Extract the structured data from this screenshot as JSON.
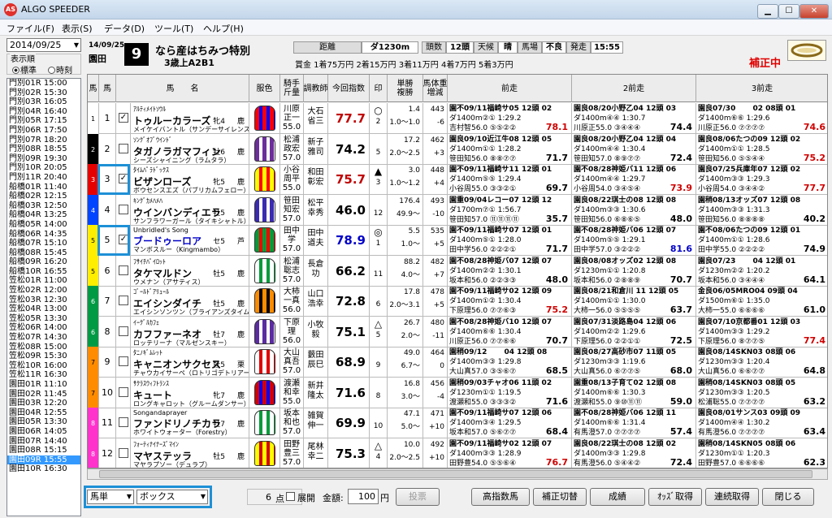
{
  "window": {
    "title": "ALGO SPEEDER",
    "logo": "AS"
  },
  "menu": [
    "ファイル(F)",
    "表示(S)",
    "データ(D)",
    "ツール(T)",
    "ヘルプ(H)"
  ],
  "sidebar": {
    "date": "2014/09/25",
    "order_label": "表示順",
    "radio_standard": "標準",
    "radio_time": "時刻",
    "races": [
      "門別01R 15:00",
      "門別02R 15:30",
      "門別03R 16:05",
      "門別04R 16:40",
      "門別05R 17:15",
      "門別06R 17:50",
      "門別07R 18:20",
      "門別08R 18:55",
      "門別09R 19:30",
      "門別10R 20:05",
      "門別11R 20:40",
      "船橋01R 11:40",
      "船橋02R 12:15",
      "船橋03R 12:50",
      "船橋04R 13:25",
      "船橋05R 14:00",
      "船橋06R 14:35",
      "船橋07R 15:10",
      "船橋08R 15:45",
      "船橋09R 16:20",
      "船橋10R 16:55",
      "笠松01R 11:00",
      "笠松02R 12:00",
      "笠松03R 12:30",
      "笠松04R 13:00",
      "笠松05R 13:30",
      "笠松06R 14:00",
      "笠松07R 14:30",
      "笠松08R 15:00",
      "笠松09R 15:30",
      "笠松10R 16:00",
      "笠松11R 16:30",
      "園田01R 11:10",
      "園田02R 11:45",
      "園田03R 12:20",
      "園田04R 12:55",
      "園田05R 13:30",
      "園田06R 14:05",
      "園田07R 14:40",
      "園田08R 15:15",
      "園田09R 15:55",
      "園田10R 16:30"
    ],
    "selected_index": 40
  },
  "race": {
    "date": "14/09/25",
    "track": "園田",
    "number": "9",
    "name": "なら産はちみつ特別",
    "condition": "3歳上A2B1",
    "info": [
      {
        "label": "距離",
        "value": "ダ1230m"
      },
      {
        "label": "頭数",
        "value": "12頭"
      },
      {
        "label": "天候",
        "value": "晴"
      },
      {
        "label": "馬場",
        "value": "不良"
      },
      {
        "label": "発走",
        "value": "15:55"
      }
    ],
    "prize": "賞金 1着75万円  2着15万円  3着11万円  4着7万円  5着3万円",
    "status": "補正中"
  },
  "headers": [
    "馬",
    "馬",
    "馬　　名",
    "服色",
    "騎手\n斤量",
    "調教師",
    "今回指数",
    "印",
    "単勝\n複勝",
    "馬体重\n増減",
    "前走",
    "2前走",
    "3前走"
  ],
  "horses": [
    {
      "frame": "1",
      "num": "1",
      "checked": true,
      "sire": "ｱﾙﾃｨﾒｲﾄｿｳﾙ",
      "sex": "牝4",
      "coat": "鹿",
      "name": "トゥルーカラーズ",
      "dam": "メイケイバントル（サンデーサイレンス）",
      "silks": [
        "#ff0000",
        "#0000ff"
      ],
      "jockey": [
        "川原",
        "正一",
        "55.0"
      ],
      "trainer": [
        "大石",
        "省三"
      ],
      "index": "77.7",
      "index_color": "red",
      "mark": "○",
      "mark_num": "2",
      "odds": [
        "1.4",
        "1.0～1.0"
      ],
      "weight": [
        "443",
        "-6"
      ],
      "prev": [
        [
          "園不09/11福崎サ05 12頭 02",
          "ダ1400m②① 1:29.2",
          "吉村智56.0 ⑤⑤②②  78.1",
          "red"
        ],
        [
          "園良08/20小野乙04 12頭 03",
          "ダ1400m④④ 1:30.7",
          "川原正55.0 ③④④④  74.4",
          ""
        ],
        [
          "園良07/30　　 02 08頭 01",
          "ダ1400m⑥⑥ 1:29.6",
          "川原正56.0 ⑦⑦⑦⑦  74.6",
          "red"
        ]
      ]
    },
    {
      "frame": "2",
      "num": "2",
      "checked": false,
      "sire": "ｿﾝｸﾞｵﾌﾞｳｲﾝﾄﾞ",
      "sex": "牡6",
      "coat": "鹿",
      "name": "タガノラガマフィン",
      "dam": "シーズシャイニング（ラムタラ）",
      "silks": [
        "#6c2e9a",
        "#ffffff"
      ],
      "jockey": [
        "松浦",
        "政宏",
        "57.0"
      ],
      "trainer": [
        "新子",
        "雅司"
      ],
      "index": "74.2",
      "index_color": "",
      "mark": "",
      "mark_num": "5",
      "odds": [
        "17.2",
        "2.0～2.5"
      ],
      "weight": [
        "462",
        "+3"
      ],
      "prev": [
        [
          "園良09/10近江牛08 12頭 05",
          "ダ1400m①① 1:28.2",
          "笹田知56.0 ⑧⑧⑦⑦  71.7",
          ""
        ],
        [
          "園良08/20小野乙04 12頭 04",
          "ダ1400m④④ 1:30.4",
          "笹田知57.0 ⑧⑨⑦⑦  72.4",
          ""
        ],
        [
          "園良08/06たつの09 12頭 02",
          "ダ1400m①① 1:28.5",
          "笹田知56.0 ⑤⑤④④  75.2",
          "red"
        ]
      ]
    },
    {
      "frame": "3",
      "num": "3",
      "checked": true,
      "sire": "ﾀｲﾑﾊﾟﾗﾄﾞｯｸｽ",
      "sex": "牝5",
      "coat": "鹿",
      "name": "ビザンローズ",
      "dam": "ボウセンスエズ（パブリカムフェロー）",
      "silks": [
        "#ffff00",
        "#ff0000"
      ],
      "jockey": [
        "小谷",
        "周平",
        "55.0"
      ],
      "trainer": [
        "和田",
        "彰宏"
      ],
      "index": "75.7",
      "index_color": "red",
      "mark": "▲",
      "mark_num": "3",
      "odds": [
        "3.0",
        "1.0～1.2"
      ],
      "weight": [
        "448",
        "+4"
      ],
      "prev": [
        [
          "園不09/11福崎サ11 12頭 01",
          "ダ1400m⑤⑤ 1:29.4",
          "小谷周55.0 ③③②①  69.7",
          ""
        ],
        [
          "園不08/28神姫バ11 12頭 06",
          "ダ1400m④④ 1:29.7",
          "小谷周54.0 ③④⑤④  73.9",
          "red"
        ],
        [
          "園良07/25兵庫年07 12頭 02",
          "ダ1400m③③ 1:29.3",
          "小谷周54.0 ③④④②  77.7",
          "red"
        ]
      ]
    },
    {
      "frame": "4",
      "num": "4",
      "checked": false,
      "sire": "ｷﾝｸﾞｶﾒﾊﾒﾊ",
      "sex": "牡5",
      "coat": "鹿",
      "name": "ウインバンディエラ",
      "dam": "サンフラワーガール（タイキシャトル）",
      "silks": [
        "#3a2bb0",
        "#ffffff"
      ],
      "jockey": [
        "笹田",
        "知宏",
        "57.0"
      ],
      "trainer": [
        "松平",
        "幸秀"
      ],
      "index": "46.0",
      "index_color": "",
      "mark": "",
      "mark_num": "12",
      "odds": [
        "176.4",
        "49.9～"
      ],
      "weight": [
        "493",
        "-10"
      ],
      "prev": [
        [
          "園重09/04レコー07 12頭 12",
          "ダ1700m⑦① 1:56.7",
          "笹田知57.0 ⑪⑪⑪⑪  35.7",
          ""
        ],
        [
          "園良08/22琪士の08 12頭 08",
          "ダ1400m③③ 1:30.6",
          "笹田知56.0 ⑥⑧⑥⑤  48.0",
          ""
        ],
        [
          "園稍08/13オッズ07 12頭 08",
          "ダ1400m③③ 1:31.3",
          "笹田知56.0 ⑧⑧⑧⑧  40.2",
          ""
        ]
      ]
    },
    {
      "frame": "5",
      "num": "5",
      "checked": true,
      "sire": "Unbridled's Song",
      "sex": "セ5",
      "coat": "芦",
      "name": "ブードゥーロア",
      "dam": "マンボスルー（Kingmambo）",
      "silks": [
        "#009b3a",
        "#ff0000"
      ],
      "jockey": [
        "田中",
        "学",
        "57.0"
      ],
      "trainer": [
        "田中",
        "道夫"
      ],
      "index": "78.9",
      "index_color": "blue",
      "mark": "◎",
      "mark_num": "1",
      "odds": [
        "5.5",
        "1.0～"
      ],
      "weight": [
        "535",
        "+5"
      ],
      "prev": [
        [
          "園不09/11福崎サ07 12頭 01",
          "ダ1400m⑤① 1:28.0",
          "田中学56.0 ②②②①  71.7",
          ""
        ],
        [
          "園不08/28神姫バ06 12頭 07",
          "ダ1400m⑤⑤ 1:29.1",
          "田中学57.0 ③②②②  81.6",
          "blue"
        ],
        [
          "園不08/06たつの09 12頭 01",
          "ダ1400m①① 1:28.6",
          "田中学55.0 ②②②②  74.9",
          ""
        ]
      ]
    },
    {
      "frame": "5",
      "num": "6",
      "checked": false,
      "sire": "ﾌｻｲﾁﾊﾟｲﾛｯﾄ",
      "sex": "牡5",
      "coat": "鹿",
      "name": "タケマルドン",
      "dam": "ウメナン（アサティス）",
      "silks": [
        "#ffffff",
        "#009b3a"
      ],
      "jockey": [
        "松浦",
        "聡志",
        "57.0"
      ],
      "trainer": [
        "長倉",
        "功"
      ],
      "index": "66.2",
      "index_color": "",
      "mark": "",
      "mark_num": "11",
      "odds": [
        "88.2",
        "4.0～"
      ],
      "weight": [
        "482",
        "+7"
      ],
      "prev": [
        [
          "園不08/28神姫バ07 12頭 07",
          "ダ1400m②② 1:30.1",
          "坂本和56.0 ②②③③  48.0",
          ""
        ],
        [
          "園良08/08オッズ02 12頭 08",
          "ダ1230m①① 1:20.8",
          "坂本和56.0 ②⑧⑧⑨  70.7",
          ""
        ],
        [
          "園良07/23　　 04 12頭 01",
          "ダ1230m②② 1:20.2",
          "坂本和56.0 ③④④④  64.1",
          ""
        ]
      ]
    },
    {
      "frame": "6",
      "num": "7",
      "checked": false,
      "sire": "ｺﾞｰﾙﾄﾞｱﾘｭｰﾙ",
      "sex": "牡5",
      "coat": "鹿",
      "name": "エイシンダイチ",
      "dam": "エイシンソンツン（ブライアンズタイム）",
      "silks": [
        "#ff8c00",
        "#000000"
      ],
      "jockey": [
        "大柿",
        "一真",
        "56.0"
      ],
      "trainer": [
        "山口",
        "浩幸"
      ],
      "index": "72.8",
      "index_color": "",
      "mark": "",
      "mark_num": "6",
      "odds": [
        "17.8",
        "2.0～3.1"
      ],
      "weight": [
        "478",
        "+5"
      ],
      "prev": [
        [
          "園不09/11福崎サ02 12頭 09",
          "ダ1400m①② 1:30.4",
          "下原理56.0 ⑦⑦⑥③  75.2",
          "red"
        ],
        [
          "園良08/21和倉川 11 12頭 05",
          "ダ1400m①① 1:30.0",
          "大柿一56.0 ⑤⑤⑤⑤  63.7",
          ""
        ],
        [
          "金良06/05MRO04 09頭 04",
          "ダ1500m⑥① 1:35.0",
          "大柿一55.0 ⑥⑥⑥⑥  61.0",
          ""
        ]
      ]
    },
    {
      "frame": "6",
      "num": "8",
      "checked": false,
      "sire": "ｲｰｸﾞﾙｶﾌｪ",
      "sex": "牡7",
      "coat": "鹿",
      "name": "カフファーネオ",
      "dam": "ロッテリーナ（マルゼンスキー）",
      "silks": [
        "#5a2ca0",
        "#ffffff"
      ],
      "jockey": [
        "下原",
        "理",
        "56.0"
      ],
      "trainer": [
        "小牧",
        "毅"
      ],
      "index": "75.1",
      "index_color": "",
      "mark": "△",
      "mark_num": "5",
      "odds": [
        "26.7",
        "2.0～"
      ],
      "weight": [
        "480",
        "-11"
      ],
      "prev": [
        [
          "園不08/28神姫バ10 12頭 07",
          "ダ1400m⑥⑥ 1:30.4",
          "川原正56.0 ⑦⑦⑥⑥  70.7",
          ""
        ],
        [
          "園良07/31淡路島04 12頭 06",
          "ダ1400m②② 1:29.6",
          "下原理56.0 ②②①①  72.5",
          ""
        ],
        [
          "園良07/10京都番01 12頭 03",
          "ダ1400m③③ 1:29.2",
          "下原理56.0 ⑧⑦⑦⑤  77.4",
          "red"
        ]
      ]
    },
    {
      "frame": "7",
      "num": "9",
      "checked": false,
      "sire": "ﾀﾆﾉｷﾞﾑﾚｯﾄ",
      "sex": "牡5",
      "coat": "栗",
      "name": "キャニオンサクセス",
      "dam": "チャウカイサーペ（ロトリゴデトリアーノ）",
      "silks": [
        "#ffffff",
        "#e00000"
      ],
      "jockey": [
        "大山",
        "真吾",
        "57.0"
      ],
      "trainer": [
        "藪田",
        "辰巳"
      ],
      "index": "68.9",
      "index_color": "",
      "mark": "",
      "mark_num": "9",
      "odds": [
        "49.0",
        "6.7～"
      ],
      "weight": [
        "464",
        "0"
      ],
      "prev": [
        [
          "園稍09/12　　 04 12頭 08",
          "ダ1400m③③ 1:29.8",
          "大山真57.0 ③⑤⑥⑦  68.5",
          ""
        ],
        [
          "園良08/27高砂市07 11頭 05",
          "ダ1230m③③ 1:19.6",
          "大山真56.0 ⑥⑦⑦⑤  68.0",
          ""
        ],
        [
          "園良08/14SKN03 08頭 06",
          "ダ1230m③③ 1:20.4",
          "大山真56.0 ⑥⑥⑦⑦  64.8",
          ""
        ]
      ]
    },
    {
      "frame": "7",
      "num": "10",
      "checked": false,
      "sire": "ｻｸﾗｽｳｨﾌﾄﾗﾝｽ",
      "sex": "牝7",
      "coat": "鹿",
      "name": "キュート",
      "dam": "ロングキャロット（グルームダンサー）",
      "silks": [
        "#d40000",
        "#0000ff"
      ],
      "jockey": [
        "渡瀬",
        "和幸",
        "55.0"
      ],
      "trainer": [
        "新井",
        "隆太"
      ],
      "index": "71.6",
      "index_color": "",
      "mark": "",
      "mark_num": "8",
      "odds": [
        "16.8",
        "3.0～"
      ],
      "weight": [
        "456",
        "-4"
      ],
      "prev": [
        [
          "園稍09/03チャオ06 11頭 02",
          "ダ1230m①① 1:19.5",
          "渡瀬和55.0 ③③③②  71.6",
          ""
        ],
        [
          "園重08/13子育て02 12頭 08",
          "ダ1400m⑥⑥ 1:30.3",
          "渡瀬和55.0 ⑨⑩⑪⑪  59.0",
          ""
        ],
        [
          "園稍08/14SKN03 08頭 05",
          "ダ1230m③③ 1:20.5",
          "松浦聡55.0 ⑦⑦⑦⑦  63.2",
          ""
        ]
      ]
    },
    {
      "frame": "8",
      "num": "11",
      "checked": false,
      "sire": "Songandaprayer",
      "sex": "牡7",
      "coat": "鹿",
      "name": "ファンドリノチカラ",
      "dam": "ホワイトウォーター（Forestry）",
      "silks": [
        "#ffffff",
        "#009b3a"
      ],
      "jockey": [
        "坂本",
        "和也",
        "57.0"
      ],
      "trainer": [
        "雑賀",
        "伸一"
      ],
      "index": "69.9",
      "index_color": "",
      "mark": "",
      "mark_num": "10",
      "odds": [
        "47.1",
        "5.0～"
      ],
      "weight": [
        "471",
        "+10"
      ],
      "prev": [
        [
          "園不09/11福崎サ07 12頭 06",
          "ダ1400m③④ 1:29.5",
          "坂本和57.0 ⑤⑥⑦⑦  68.4",
          ""
        ],
        [
          "園不08/28神姫バ06 12頭 11",
          "ダ1400m⑥⑥ 1:31.4",
          "有馬澄57.0 ⑦⑦⑦⑦  57.4",
          ""
        ],
        [
          "園良08/01サンス03 09頭 09",
          "ダ1400m④④ 1:30.2",
          "有馬澄56.0 ⑦⑦⑦⑦  63.4",
          ""
        ]
      ]
    },
    {
      "frame": "8",
      "num": "12",
      "checked": false,
      "sire": "ﾌｫｰﾃｨﾅｲﾅｰｽﾞﾏｲﾝ",
      "sex": "牡5",
      "coat": "鹿",
      "name": "マヤステッラ",
      "dam": "マヤラプソー（デュラブ）",
      "silks": [
        "#ffff00",
        "#d40000"
      ],
      "jockey": [
        "田野",
        "豊三",
        "57.0"
      ],
      "trainer": [
        "尾林",
        "幸二"
      ],
      "index": "75.3",
      "index_color": "",
      "mark": "△",
      "mark_num": "4",
      "odds": [
        "10.0",
        "2.0～2.5"
      ],
      "weight": [
        "492",
        "+10"
      ],
      "prev": [
        [
          "園不09/11福崎サ02 12頭 07",
          "ダ1400m③③ 1:28.9",
          "田野豊54.0 ⑤⑤⑥④  76.7",
          "red"
        ],
        [
          "園良08/22琪士の08 12頭 02",
          "ダ1400m③③ 1:29.8",
          "有馬澄56.0 ⑤④④②  72.4",
          ""
        ],
        [
          "園稍08/14SKN05 08頭 06",
          "ダ1230m①① 1:20.3",
          "田野豊57.0 ⑥⑥⑥⑥  62.3",
          ""
        ]
      ]
    }
  ],
  "bottom": {
    "bet_type": "馬単",
    "bet_mode": "ボックス",
    "points": "6",
    "points_unit": "点",
    "expand_label": "展開",
    "amount_label": "金額:",
    "amount": "100",
    "yen": "円",
    "buttons": [
      "投票",
      "高指数馬",
      "補正切替",
      "成績",
      "ｵｯｽﾞ取得",
      "連続取得",
      "閉じる"
    ]
  }
}
